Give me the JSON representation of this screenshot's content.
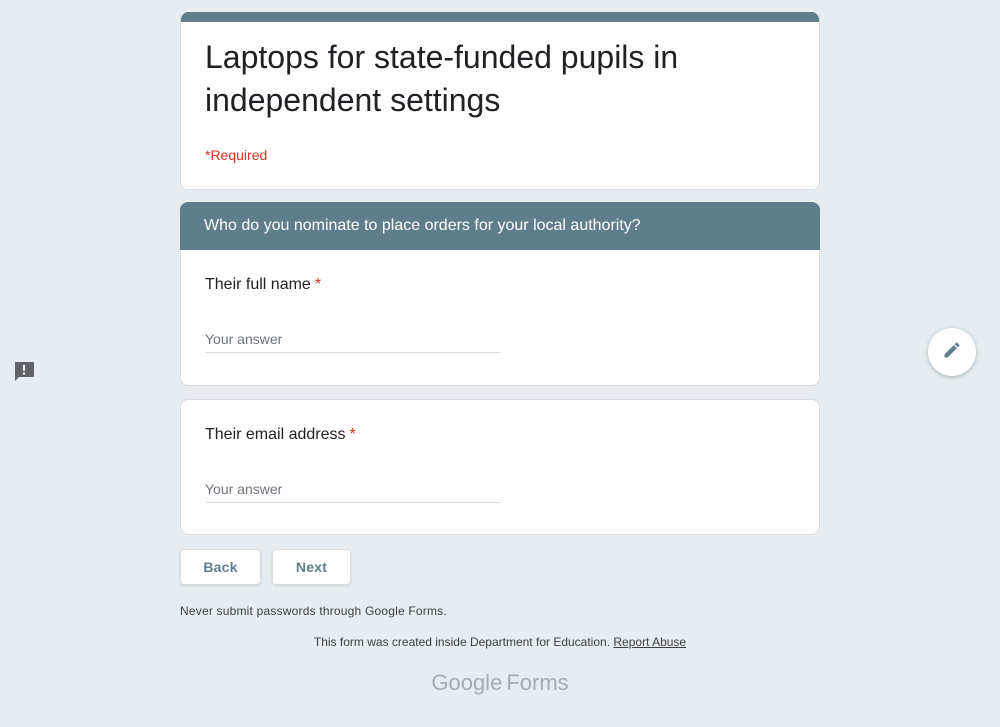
{
  "form": {
    "title": "Laptops for state-funded pupils in independent settings",
    "required_note": "*Required",
    "accent_color": "#607d8b",
    "background_color": "#e6ecef"
  },
  "section": {
    "title": "Who do you nominate to place orders for your local authority?"
  },
  "questions": [
    {
      "label": "Their full name",
      "required_mark": "*",
      "placeholder": "Your answer",
      "value": ""
    },
    {
      "label": "Their email address",
      "required_mark": "*",
      "placeholder": "Your answer",
      "value": ""
    }
  ],
  "buttons": {
    "back": "Back",
    "next": "Next"
  },
  "footer": {
    "warning": "Never submit passwords through Google Forms.",
    "created_text": "This form was created inside Department for Education.",
    "report_link": "Report Abuse"
  },
  "brand": {
    "google": "Google",
    "forms": "Forms"
  },
  "icons": {
    "feedback": "feedback-icon",
    "edit": "pencil-icon"
  }
}
